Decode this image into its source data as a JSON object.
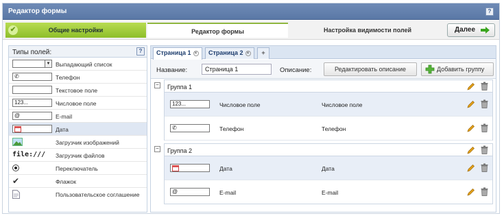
{
  "window": {
    "title": "Редактор формы"
  },
  "steps": [
    {
      "label": "Общие настройки"
    },
    {
      "label": "Редактор формы"
    },
    {
      "label": "Настройка видимости полей"
    }
  ],
  "next_button": "Далее",
  "field_types": {
    "header": "Типы полей:",
    "items": [
      {
        "label": "Выпадающий список",
        "preview": ""
      },
      {
        "label": "Телефон",
        "preview": ""
      },
      {
        "label": "Текстовое поле",
        "preview": ""
      },
      {
        "label": "Числовое поле",
        "preview": "123..."
      },
      {
        "label": "E-mail",
        "preview": "@"
      },
      {
        "label": "Дата",
        "preview": ""
      },
      {
        "label": "Загрузчик изображений",
        "preview": ""
      },
      {
        "label": "Загрузчик файлов",
        "preview": "file:///"
      },
      {
        "label": "Переключатель",
        "preview": ""
      },
      {
        "label": "Флажок",
        "preview": ""
      },
      {
        "label": "Пользовательское соглашение",
        "preview": ""
      }
    ]
  },
  "tabs": [
    {
      "label": "Страница 1",
      "active": true
    },
    {
      "label": "Страница 2",
      "active": false
    },
    {
      "label": "+"
    }
  ],
  "page_props": {
    "name_label": "Название:",
    "name_value": "Страница 1",
    "description_label": "Описание:",
    "edit_description_button": "Редактировать описание",
    "add_group_button": "Добавить группу"
  },
  "groups": [
    {
      "title": "Группа 1",
      "toggle": "−",
      "fields": [
        {
          "preview": "123...",
          "label": "Числовое поле",
          "type": "Числовое поле"
        },
        {
          "preview": "",
          "label": "Телефон",
          "type": "Телефон"
        }
      ]
    },
    {
      "title": "Группа 2",
      "toggle": "−",
      "fields": [
        {
          "preview": "",
          "label": "Дата",
          "type": "Дата"
        },
        {
          "preview": "@",
          "label": "E-mail",
          "type": "E-mail"
        }
      ]
    }
  ],
  "colors": {
    "titlebar": "#6481b0",
    "step_done": "#a3cd3c",
    "accent_green": "#4caf27",
    "pencil": "#e3a11a"
  }
}
